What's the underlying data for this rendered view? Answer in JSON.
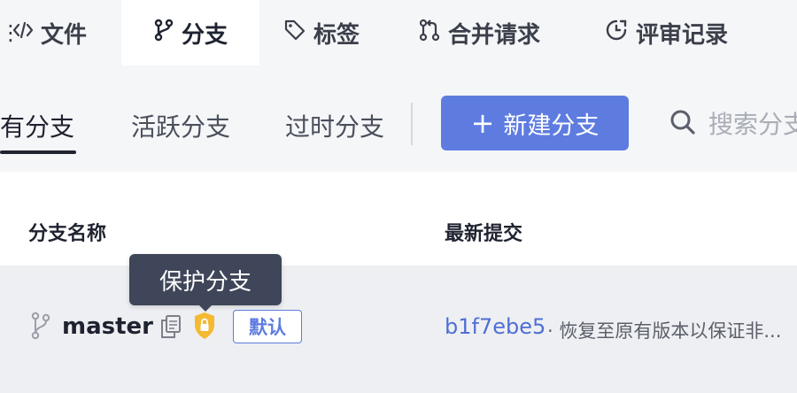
{
  "tabs": [
    {
      "label": "文件",
      "icon": "code-icon"
    },
    {
      "label": "分支",
      "icon": "branch-icon",
      "active": true
    },
    {
      "label": "标签",
      "icon": "tag-icon"
    },
    {
      "label": "合并请求",
      "icon": "merge-request-icon"
    },
    {
      "label": "评审记录",
      "icon": "review-clock-icon"
    }
  ],
  "more_label": "⋮",
  "filters": {
    "all": "所有分支",
    "active": "活跃分支",
    "stale": "过时分支"
  },
  "new_branch": {
    "plus": "+",
    "label": "新建分支"
  },
  "search": {
    "placeholder": "搜索分支"
  },
  "table": {
    "headers": {
      "name": "分支名称",
      "commit": "最新提交"
    },
    "rows": [
      {
        "branch": "master",
        "badge": "默认",
        "commit_hash": "b1f7ebe5",
        "commit_message": "· 恢复至原有版本以保证非..."
      }
    ]
  },
  "tooltip": {
    "text": "保护分支"
  },
  "colors": {
    "accent": "#5e7ce0",
    "link": "#4e6fd6",
    "tooltip_bg": "#3f4659",
    "shield": "#f5b932"
  }
}
